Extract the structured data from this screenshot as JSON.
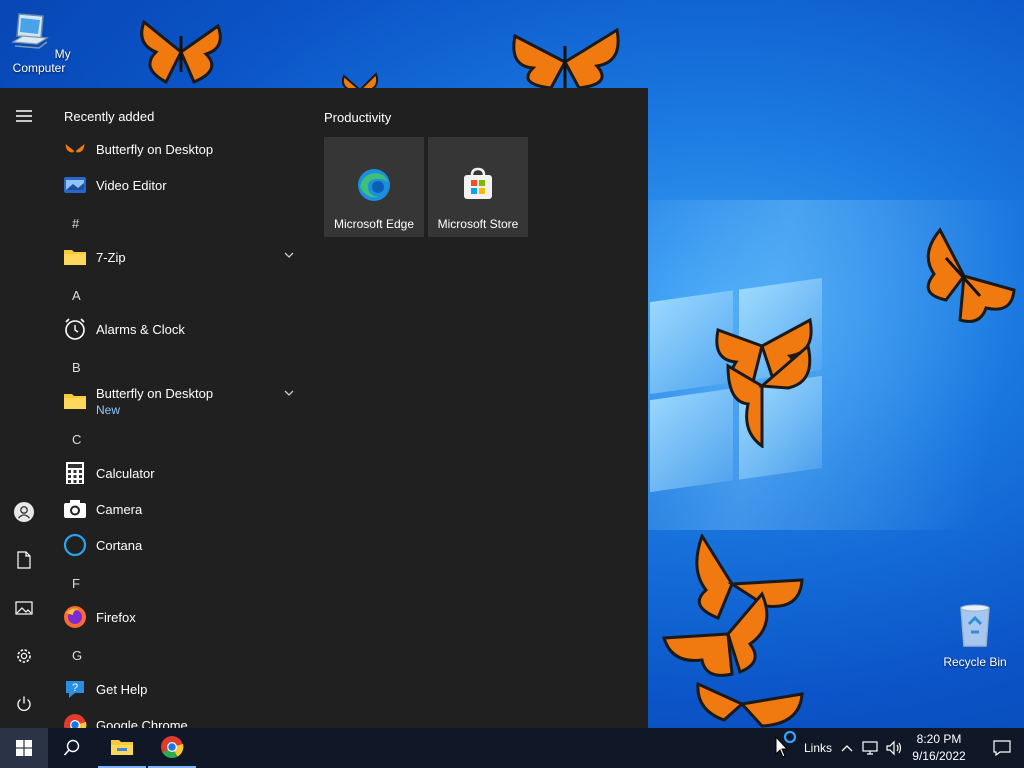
{
  "desktop": {
    "icons": {
      "my_computer": "My Computer",
      "recycle_bin": "Recycle Bin"
    }
  },
  "start_menu": {
    "recently_added_label": "Recently added",
    "recent": [
      {
        "label": "Butterfly on Desktop",
        "icon": "butterfly-icon"
      },
      {
        "label": "Video Editor",
        "icon": "video-editor-icon"
      }
    ],
    "groups": {
      "hash": "#",
      "a": "A",
      "b": "B",
      "c": "C",
      "f": "F",
      "g": "G"
    },
    "apps": {
      "seven_zip": "7-Zip",
      "alarms": "Alarms & Clock",
      "butterfly_folder": "Butterfly on Desktop",
      "butterfly_new": "New",
      "calculator": "Calculator",
      "camera": "Camera",
      "cortana": "Cortana",
      "firefox": "Firefox",
      "get_help": "Get Help",
      "chrome": "Google Chrome"
    },
    "tiles": {
      "group_title": "Productivity",
      "edge": "Microsoft Edge",
      "store": "Microsoft Store"
    }
  },
  "taskbar": {
    "links_label": "Links",
    "time": "8:20 PM",
    "date": "9/16/2022"
  }
}
